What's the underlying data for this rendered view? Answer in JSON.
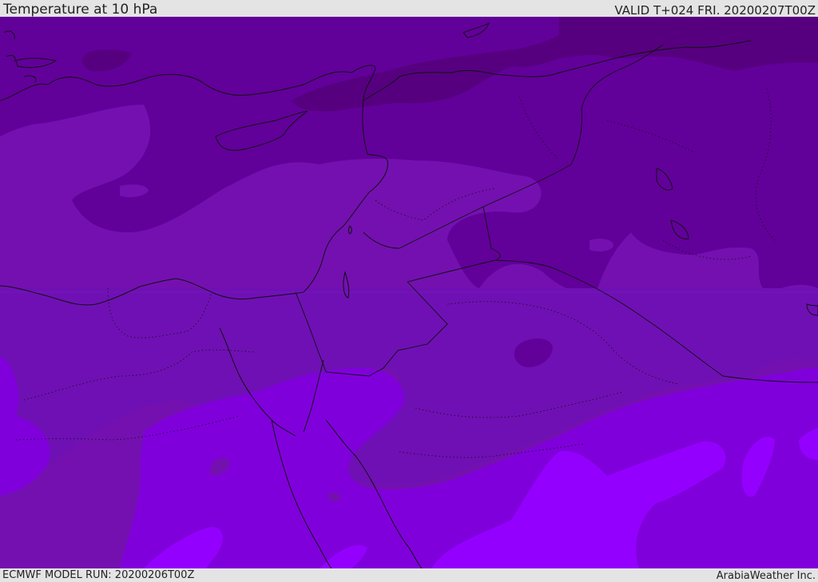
{
  "header": {
    "title": "Temperature at 10 hPa",
    "valid": "VALID T+024 FRI. 20200207T00Z"
  },
  "footer": {
    "model_run": "ECMWF MODEL RUN: 20200206T00Z",
    "credit": "ArabiaWeather Inc."
  },
  "map": {
    "variable": "temperature",
    "level": "10 hPa",
    "region": "Eastern Mediterranean / Middle East",
    "palette": {
      "coldest": "#560080",
      "colder": "#62009a",
      "cold": "#6f10b4",
      "mid": "#7410b0",
      "warm": "#8000dc",
      "warmer": "#8c00f2",
      "warmest": "#9400fe"
    },
    "coastline_color": "#111111",
    "border_style": "solid",
    "internal_boundary_style": "dotted"
  }
}
